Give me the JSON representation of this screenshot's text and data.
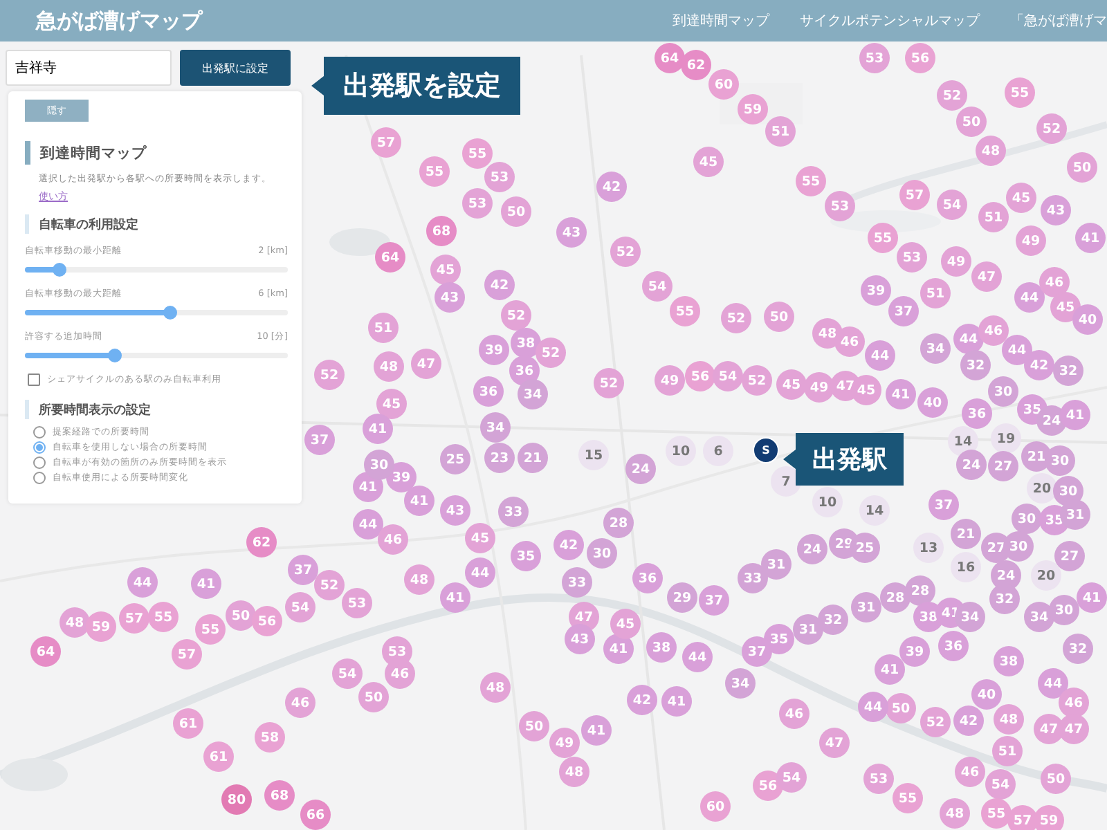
{
  "header": {
    "title": "急がば漕げマップ",
    "nav": [
      "到達時間マップ",
      "サイクルポテンシャルマップ",
      "「急がば漕げマ"
    ]
  },
  "search": {
    "value": "吉祥寺",
    "button": "出発駅に設定"
  },
  "callouts": [
    {
      "text": "出発駅を設定"
    },
    {
      "text": "出発駅"
    }
  ],
  "panel": {
    "hide_button": "隠す",
    "title": "到達時間マップ",
    "description": "選択した出発駅から各駅への所要時間を表示します。",
    "link": "使い方",
    "bike_section": "自転車の利用設定",
    "sliders": [
      {
        "label": "自転車移動の最小距離",
        "reading": "2 [km]",
        "level": 0.13
      },
      {
        "label": "自転車移動の最大距離",
        "reading": "6 [km]",
        "level": 0.55
      },
      {
        "label": "許容する追加時間",
        "reading": "10 [分]",
        "level": 0.34
      }
    ],
    "checkbox": {
      "label": "シェアサイクルのある駅のみ自転車利用",
      "checked": false
    },
    "display_section": "所要時間表示の設定",
    "radios": [
      {
        "label": "提案経路での所要時間",
        "selected": false
      },
      {
        "label": "自転車を使用しない場合の所要時間",
        "selected": true
      },
      {
        "label": "自転車が有効の箇所のみ所要時間を表示",
        "selected": false
      },
      {
        "label": "自転車使用による所要時間変化",
        "selected": false
      }
    ]
  },
  "stations": [
    {
      "label": "64",
      "color": "#e68cc6",
      "kind": "far"
    },
    {
      "label": "62",
      "color": "#e68cc6",
      "kind": "far"
    },
    {
      "label": "60",
      "color": "#e9a2d3",
      "kind": "far"
    },
    {
      "label": "59",
      "color": "#e9a2d3",
      "kind": "far"
    },
    {
      "label": "51",
      "color": "#e3a3d6",
      "kind": "far"
    },
    {
      "label": "45",
      "color": "#e3a3d6",
      "kind": "far"
    },
    {
      "label": "42",
      "color": "#d9a0d9",
      "kind": "far"
    },
    {
      "label": "55",
      "color": "#e9a2d3",
      "kind": "far"
    },
    {
      "label": "53",
      "color": "#e3a3d6",
      "kind": "far"
    },
    {
      "label": "55",
      "color": "#e9a2d3",
      "kind": "far"
    },
    {
      "label": "53",
      "color": "#e3a3d6",
      "kind": "far"
    },
    {
      "label": "43",
      "color": "#d9a0d9",
      "kind": "far"
    },
    {
      "label": "52",
      "color": "#e3a3d6",
      "kind": "far"
    },
    {
      "label": "54",
      "color": "#e3a3d6",
      "kind": "far"
    },
    {
      "label": "55",
      "color": "#e9a2d3",
      "kind": "far"
    },
    {
      "label": "52",
      "color": "#e3a3d6",
      "kind": "far"
    },
    {
      "label": "50",
      "color": "#e3a3d6",
      "kind": "far"
    },
    {
      "label": "48",
      "color": "#e3a3d6",
      "kind": "far"
    },
    {
      "label": "46",
      "color": "#e3a3d6",
      "kind": "far"
    },
    {
      "label": "39",
      "color": "#d9a0d9",
      "kind": "far"
    },
    {
      "label": "44",
      "color": "#d9a0d9",
      "kind": "far"
    },
    {
      "label": "37",
      "color": "#d9a0d9",
      "kind": "far"
    },
    {
      "label": "51",
      "color": "#e3a3d6",
      "kind": "far"
    },
    {
      "label": "49",
      "color": "#e3a3d6",
      "kind": "far"
    },
    {
      "label": "47",
      "color": "#e3a3d6",
      "kind": "far"
    },
    {
      "label": "44",
      "color": "#d9a0d9",
      "kind": "far"
    },
    {
      "label": "46",
      "color": "#e3a3d6",
      "kind": "far"
    },
    {
      "label": "45",
      "color": "#e3a3d6",
      "kind": "far"
    },
    {
      "label": "40",
      "color": "#d9a0d9",
      "kind": "far"
    },
    {
      "label": "57",
      "color": "#e9a2d3",
      "kind": "far"
    },
    {
      "label": "54",
      "color": "#e3a3d6",
      "kind": "far"
    },
    {
      "label": "51",
      "color": "#e3a3d6",
      "kind": "far"
    },
    {
      "label": "49",
      "color": "#e3a3d6",
      "kind": "far"
    },
    {
      "label": "45",
      "color": "#e3a3d6",
      "kind": "far"
    },
    {
      "label": "43",
      "color": "#d9a0d9",
      "kind": "far"
    },
    {
      "label": "52",
      "color": "#e3a3d6",
      "kind": "far"
    },
    {
      "label": "50",
      "color": "#e3a3d6",
      "kind": "far"
    },
    {
      "label": "48",
      "color": "#e3a3d6",
      "kind": "far"
    },
    {
      "label": "55",
      "color": "#e9a2d3",
      "kind": "far"
    },
    {
      "label": "52",
      "color": "#e3a3d6",
      "kind": "far"
    },
    {
      "label": "50",
      "color": "#e3a3d6",
      "kind": "far"
    },
    {
      "label": "53",
      "color": "#e3a3d6",
      "kind": "far"
    },
    {
      "label": "56",
      "color": "#e9a2d3",
      "kind": "far"
    },
    {
      "label": "41",
      "color": "#d9a0d9",
      "kind": "far"
    },
    {
      "label": "34",
      "color": "#d3a4d6",
      "kind": "far"
    },
    {
      "label": "44",
      "color": "#d9a0d9",
      "kind": "far"
    },
    {
      "label": "46",
      "color": "#e3a3d6",
      "kind": "far"
    },
    {
      "label": "44",
      "color": "#d9a0d9",
      "kind": "far"
    },
    {
      "label": "32",
      "color": "#d3a4d6",
      "kind": "far"
    },
    {
      "label": "42",
      "color": "#d9a0d9",
      "kind": "far"
    },
    {
      "label": "30",
      "color": "#d3a4d6",
      "kind": "far"
    },
    {
      "label": "32",
      "color": "#d3a4d6",
      "kind": "far"
    },
    {
      "label": "52",
      "color": "#e3a3d6",
      "kind": "far"
    },
    {
      "label": "49",
      "color": "#e3a3d6",
      "kind": "far"
    },
    {
      "label": "56",
      "color": "#e9a2d3",
      "kind": "far"
    },
    {
      "label": "54",
      "color": "#e3a3d6",
      "kind": "far"
    },
    {
      "label": "52",
      "color": "#e3a3d6",
      "kind": "far"
    },
    {
      "label": "45",
      "color": "#e3a3d6",
      "kind": "far"
    },
    {
      "label": "49",
      "color": "#e3a3d6",
      "kind": "far"
    },
    {
      "label": "47",
      "color": "#e3a3d6",
      "kind": "far"
    },
    {
      "label": "45",
      "color": "#e3a3d6",
      "kind": "far"
    },
    {
      "label": "41",
      "color": "#d9a0d9",
      "kind": "far"
    },
    {
      "label": "40",
      "color": "#d9a0d9",
      "kind": "far"
    },
    {
      "label": "36",
      "color": "#d9a0d9",
      "kind": "far"
    },
    {
      "label": "35",
      "color": "#d9a0d9",
      "kind": "far"
    },
    {
      "label": "24",
      "color": "#d3a4d6",
      "kind": "far"
    },
    {
      "label": "41",
      "color": "#d9a0d9",
      "kind": "far"
    },
    {
      "label": "15",
      "color": "#ece3f0",
      "kind": "near"
    },
    {
      "label": "24",
      "color": "#d3a4d6",
      "kind": "far"
    },
    {
      "label": "10",
      "color": "#ece3f0",
      "kind": "near"
    },
    {
      "label": "6",
      "color": "#ece3f0",
      "kind": "near"
    },
    {
      "label": "S",
      "kind": "start"
    },
    {
      "label": "7",
      "color": "#ece3f0",
      "kind": "near"
    },
    {
      "label": "10",
      "color": "#ece3f0",
      "kind": "near"
    },
    {
      "label": "14",
      "color": "#ece3f0",
      "kind": "near"
    },
    {
      "label": "14",
      "color": "#ece3f0",
      "kind": "near"
    },
    {
      "label": "19",
      "color": "#ece3f0",
      "kind": "near"
    },
    {
      "label": "24",
      "color": "#d3a4d6",
      "kind": "far"
    },
    {
      "label": "27",
      "color": "#d3a4d6",
      "kind": "far"
    },
    {
      "label": "21",
      "color": "#d3a4d6",
      "kind": "far"
    },
    {
      "label": "30",
      "color": "#d3a4d6",
      "kind": "far"
    },
    {
      "label": "20",
      "color": "#ece3f0",
      "kind": "near"
    },
    {
      "label": "30",
      "color": "#d3a4d6",
      "kind": "far"
    },
    {
      "label": "37",
      "color": "#d9a0d9",
      "kind": "far"
    },
    {
      "label": "30",
      "color": "#d3a4d6",
      "kind": "far"
    },
    {
      "label": "35",
      "color": "#d9a0d9",
      "kind": "far"
    },
    {
      "label": "31",
      "color": "#d3a4d6",
      "kind": "far"
    },
    {
      "label": "27",
      "color": "#d3a4d6",
      "kind": "far"
    },
    {
      "label": "28",
      "color": "#d3a4d6",
      "kind": "far"
    },
    {
      "label": "42",
      "color": "#d9a0d9",
      "kind": "far"
    },
    {
      "label": "30",
      "color": "#d3a4d6",
      "kind": "far"
    },
    {
      "label": "33",
      "color": "#d3a4d6",
      "kind": "far"
    },
    {
      "label": "36",
      "color": "#d9a0d9",
      "kind": "far"
    },
    {
      "label": "29",
      "color": "#d3a4d6",
      "kind": "far"
    },
    {
      "label": "37",
      "color": "#d9a0d9",
      "kind": "far"
    },
    {
      "label": "33",
      "color": "#d3a4d6",
      "kind": "far"
    },
    {
      "label": "31",
      "color": "#d3a4d6",
      "kind": "far"
    },
    {
      "label": "24",
      "color": "#d3a4d6",
      "kind": "far"
    },
    {
      "label": "29",
      "color": "#d3a4d6",
      "kind": "far"
    },
    {
      "label": "25",
      "color": "#d3a4d6",
      "kind": "far"
    },
    {
      "label": "13",
      "color": "#ece3f0",
      "kind": "near"
    },
    {
      "label": "21",
      "color": "#d3a4d6",
      "kind": "far"
    },
    {
      "label": "27",
      "color": "#d3a4d6",
      "kind": "far"
    },
    {
      "label": "30",
      "color": "#d3a4d6",
      "kind": "far"
    },
    {
      "label": "16",
      "color": "#ece3f0",
      "kind": "near"
    },
    {
      "label": "24",
      "color": "#d3a4d6",
      "kind": "far"
    },
    {
      "label": "20",
      "color": "#ece3f0",
      "kind": "near"
    },
    {
      "label": "28",
      "color": "#d3a4d6",
      "kind": "far"
    },
    {
      "label": "28",
      "color": "#d3a4d6",
      "kind": "far"
    },
    {
      "label": "31",
      "color": "#d3a4d6",
      "kind": "far"
    },
    {
      "label": "32",
      "color": "#d3a4d6",
      "kind": "far"
    },
    {
      "label": "31",
      "color": "#d3a4d6",
      "kind": "far"
    },
    {
      "label": "35",
      "color": "#d9a0d9",
      "kind": "far"
    },
    {
      "label": "37",
      "color": "#d9a0d9",
      "kind": "far"
    },
    {
      "label": "38",
      "color": "#d9a0d9",
      "kind": "far"
    },
    {
      "label": "44",
      "color": "#d9a0d9",
      "kind": "far"
    },
    {
      "label": "34",
      "color": "#d3a4d6",
      "kind": "far"
    },
    {
      "label": "41",
      "color": "#d9a0d9",
      "kind": "far"
    },
    {
      "label": "47",
      "color": "#e3a3d6",
      "kind": "far"
    },
    {
      "label": "45",
      "color": "#e3a3d6",
      "kind": "far"
    },
    {
      "label": "43",
      "color": "#d9a0d9",
      "kind": "far"
    },
    {
      "label": "38",
      "color": "#d9a0d9",
      "kind": "far"
    },
    {
      "label": "41",
      "color": "#d9a0d9",
      "kind": "far"
    },
    {
      "label": "34",
      "color": "#d3a4d6",
      "kind": "far"
    },
    {
      "label": "32",
      "color": "#d3a4d6",
      "kind": "far"
    },
    {
      "label": "41",
      "color": "#d9a0d9",
      "kind": "far"
    },
    {
      "label": "34",
      "color": "#d3a4d6",
      "kind": "far"
    },
    {
      "label": "30",
      "color": "#d3a4d6",
      "kind": "far"
    },
    {
      "label": "39",
      "color": "#d9a0d9",
      "kind": "far"
    },
    {
      "label": "36",
      "color": "#d9a0d9",
      "kind": "far"
    },
    {
      "label": "41",
      "color": "#d9a0d9",
      "kind": "far"
    },
    {
      "label": "38",
      "color": "#d9a0d9",
      "kind": "far"
    },
    {
      "label": "32",
      "color": "#d3a4d6",
      "kind": "far"
    },
    {
      "label": "44",
      "color": "#d9a0d9",
      "kind": "far"
    },
    {
      "label": "40",
      "color": "#d9a0d9",
      "kind": "far"
    },
    {
      "label": "46",
      "color": "#e3a3d6",
      "kind": "far"
    },
    {
      "label": "50",
      "color": "#e3a3d6",
      "kind": "far"
    },
    {
      "label": "52",
      "color": "#e3a3d6",
      "kind": "far"
    },
    {
      "label": "42",
      "color": "#d9a0d9",
      "kind": "far"
    },
    {
      "label": "48",
      "color": "#e3a3d6",
      "kind": "far"
    },
    {
      "label": "47",
      "color": "#e3a3d6",
      "kind": "far"
    },
    {
      "label": "47",
      "color": "#e3a3d6",
      "kind": "far"
    },
    {
      "label": "46",
      "color": "#e3a3d6",
      "kind": "far"
    },
    {
      "label": "44",
      "color": "#d9a0d9",
      "kind": "far"
    },
    {
      "label": "42",
      "color": "#d9a0d9",
      "kind": "far"
    },
    {
      "label": "41",
      "color": "#d9a0d9",
      "kind": "far"
    },
    {
      "label": "41",
      "color": "#d9a0d9",
      "kind": "far"
    },
    {
      "label": "49",
      "color": "#e3a3d6",
      "kind": "far"
    },
    {
      "label": "48",
      "color": "#e3a3d6",
      "kind": "far"
    },
    {
      "label": "47",
      "color": "#e3a3d6",
      "kind": "far"
    },
    {
      "label": "56",
      "color": "#e9a2d3",
      "kind": "far"
    },
    {
      "label": "54",
      "color": "#e3a3d6",
      "kind": "far"
    },
    {
      "label": "53",
      "color": "#e3a3d6",
      "kind": "far"
    },
    {
      "label": "55",
      "color": "#e9a2d3",
      "kind": "far"
    },
    {
      "label": "51",
      "color": "#e3a3d6",
      "kind": "far"
    },
    {
      "label": "54",
      "color": "#e3a3d6",
      "kind": "far"
    },
    {
      "label": "46",
      "color": "#e3a3d6",
      "kind": "far"
    },
    {
      "label": "50",
      "color": "#e3a3d6",
      "kind": "far"
    },
    {
      "label": "48",
      "color": "#e3a3d6",
      "kind": "far"
    },
    {
      "label": "55",
      "color": "#e9a2d3",
      "kind": "far"
    },
    {
      "label": "57",
      "color": "#e9a2d3",
      "kind": "far"
    },
    {
      "label": "59",
      "color": "#e9a2d3",
      "kind": "far"
    },
    {
      "label": "60",
      "color": "#e9a2d3",
      "kind": "far"
    },
    {
      "label": "41",
      "color": "#d9a0d9",
      "kind": "far"
    },
    {
      "label": "39",
      "color": "#d9a0d9",
      "kind": "far"
    },
    {
      "label": "41",
      "color": "#d9a0d9",
      "kind": "far"
    },
    {
      "label": "43",
      "color": "#d9a0d9",
      "kind": "far"
    },
    {
      "label": "33",
      "color": "#d3a4d6",
      "kind": "far"
    },
    {
      "label": "44",
      "color": "#d9a0d9",
      "kind": "far"
    },
    {
      "label": "46",
      "color": "#e3a3d6",
      "kind": "far"
    },
    {
      "label": "45",
      "color": "#e3a3d6",
      "kind": "far"
    },
    {
      "label": "44",
      "color": "#d9a0d9",
      "kind": "far"
    },
    {
      "label": "35",
      "color": "#d9a0d9",
      "kind": "far"
    },
    {
      "label": "62",
      "color": "#e68cc6",
      "kind": "far"
    },
    {
      "label": "44",
      "color": "#d9a0d9",
      "kind": "far"
    },
    {
      "label": "37",
      "color": "#d9a0d9",
      "kind": "far"
    },
    {
      "label": "41",
      "color": "#d9a0d9",
      "kind": "far"
    },
    {
      "label": "52",
      "color": "#e3a3d6",
      "kind": "far"
    },
    {
      "label": "48",
      "color": "#e3a3d6",
      "kind": "far"
    },
    {
      "label": "41",
      "color": "#d9a0d9",
      "kind": "far"
    },
    {
      "label": "48",
      "color": "#e3a3d6",
      "kind": "far"
    },
    {
      "label": "59",
      "color": "#e9a2d3",
      "kind": "far"
    },
    {
      "label": "57",
      "color": "#e9a2d3",
      "kind": "far"
    },
    {
      "label": "55",
      "color": "#e9a2d3",
      "kind": "far"
    },
    {
      "label": "55",
      "color": "#e9a2d3",
      "kind": "far"
    },
    {
      "label": "50",
      "color": "#e3a3d6",
      "kind": "far"
    },
    {
      "label": "56",
      "color": "#e9a2d3",
      "kind": "far"
    },
    {
      "label": "54",
      "color": "#e3a3d6",
      "kind": "far"
    },
    {
      "label": "53",
      "color": "#e3a3d6",
      "kind": "far"
    },
    {
      "label": "53",
      "color": "#e3a3d6",
      "kind": "far"
    },
    {
      "label": "54",
      "color": "#e3a3d6",
      "kind": "far"
    },
    {
      "label": "46",
      "color": "#e3a3d6",
      "kind": "far"
    },
    {
      "label": "50",
      "color": "#e3a3d6",
      "kind": "far"
    },
    {
      "label": "64",
      "color": "#e68cc6",
      "kind": "far"
    },
    {
      "label": "57",
      "color": "#e9a2d3",
      "kind": "far"
    },
    {
      "label": "61",
      "color": "#e9a2d3",
      "kind": "far"
    },
    {
      "label": "58",
      "color": "#e9a2d3",
      "kind": "far"
    },
    {
      "label": "46",
      "color": "#e3a3d6",
      "kind": "far"
    },
    {
      "label": "61",
      "color": "#e9a2d3",
      "kind": "far"
    },
    {
      "label": "80",
      "color": "#e27ab3",
      "kind": "far"
    },
    {
      "label": "68",
      "color": "#e68cc6",
      "kind": "far"
    },
    {
      "label": "66",
      "color": "#e68cc6",
      "kind": "far"
    },
    {
      "label": "50",
      "color": "#e3a3d6",
      "kind": "far"
    },
    {
      "label": "48",
      "color": "#e3a3d6",
      "kind": "far"
    },
    {
      "label": "57",
      "color": "#e9a2d3",
      "kind": "far"
    },
    {
      "label": "55",
      "color": "#e9a2d3",
      "kind": "far"
    },
    {
      "label": "55",
      "color": "#e9a2d3",
      "kind": "far"
    },
    {
      "label": "53",
      "color": "#e3a3d6",
      "kind": "far"
    },
    {
      "label": "53",
      "color": "#e3a3d6",
      "kind": "far"
    },
    {
      "label": "50",
      "color": "#e3a3d6",
      "kind": "far"
    },
    {
      "label": "68",
      "color": "#e68cc6",
      "kind": "far"
    },
    {
      "label": "64",
      "color": "#e68cc6",
      "kind": "far"
    },
    {
      "label": "45",
      "color": "#e3a3d6",
      "kind": "far"
    },
    {
      "label": "43",
      "color": "#d9a0d9",
      "kind": "far"
    },
    {
      "label": "42",
      "color": "#d9a0d9",
      "kind": "far"
    },
    {
      "label": "51",
      "color": "#e3a3d6",
      "kind": "far"
    },
    {
      "label": "48",
      "color": "#e3a3d6",
      "kind": "far"
    },
    {
      "label": "47",
      "color": "#e3a3d6",
      "kind": "far"
    },
    {
      "label": "52",
      "color": "#e3a3d6",
      "kind": "far"
    },
    {
      "label": "52",
      "color": "#e3a3d6",
      "kind": "far"
    },
    {
      "label": "38",
      "color": "#d9a0d9",
      "kind": "far"
    },
    {
      "label": "39",
      "color": "#d9a0d9",
      "kind": "far"
    },
    {
      "label": "52",
      "color": "#e3a3d6",
      "kind": "far"
    },
    {
      "label": "36",
      "color": "#d9a0d9",
      "kind": "far"
    },
    {
      "label": "36",
      "color": "#d9a0d9",
      "kind": "far"
    },
    {
      "label": "34",
      "color": "#d3a4d6",
      "kind": "far"
    },
    {
      "label": "45",
      "color": "#e3a3d6",
      "kind": "far"
    },
    {
      "label": "41",
      "color": "#d9a0d9",
      "kind": "far"
    },
    {
      "label": "37",
      "color": "#d9a0d9",
      "kind": "far"
    },
    {
      "label": "34",
      "color": "#d3a4d6",
      "kind": "far"
    },
    {
      "label": "30",
      "color": "#d3a4d6",
      "kind": "far"
    },
    {
      "label": "25",
      "color": "#d3a4d6",
      "kind": "far"
    },
    {
      "label": "23",
      "color": "#d3a4d6",
      "kind": "far"
    },
    {
      "label": "21",
      "color": "#d3a4d6",
      "kind": "far"
    }
  ]
}
